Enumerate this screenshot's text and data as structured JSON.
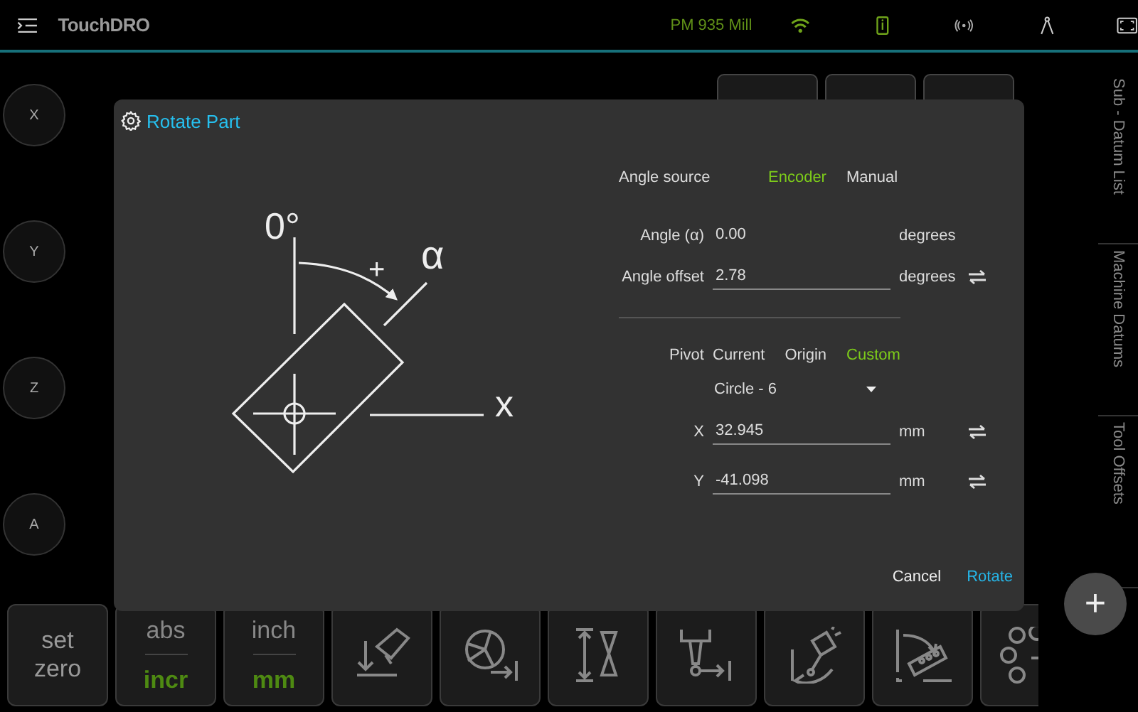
{
  "topbar": {
    "app_name": "TouchDRO",
    "machine": "PM 935 Mill"
  },
  "axes": [
    {
      "label": "X"
    },
    {
      "label": "Y"
    },
    {
      "label": "Z"
    },
    {
      "label": "A"
    }
  ],
  "side_tabs": [
    {
      "label": "Sub - Datum List"
    },
    {
      "label": "Machine Datums"
    },
    {
      "label": "Tool Offsets"
    }
  ],
  "dialog": {
    "title": "Rotate Part",
    "diagram_labels": [
      {
        "kind": "zero",
        "text": "0°"
      },
      {
        "kind": "plus",
        "text": "+"
      },
      {
        "kind": "alpha",
        "text": "α"
      },
      {
        "kind": "axis",
        "text": "x"
      }
    ],
    "angle_source": {
      "label": "Angle source",
      "options": [
        {
          "label": "Encoder",
          "selected": true
        },
        {
          "label": "Manual",
          "selected": false
        }
      ]
    },
    "fields": [
      {
        "kind": "readonly",
        "label": "Angle (α)",
        "value": "0.00",
        "unit": "degrees",
        "swap": false
      },
      {
        "kind": "input",
        "label": "Angle offset",
        "value": "2.78",
        "unit": "degrees",
        "swap": true
      }
    ],
    "pivot": {
      "label": "Pivot",
      "options": [
        {
          "label": "Current",
          "selected": false
        },
        {
          "label": "Origin",
          "selected": false
        },
        {
          "label": "Custom",
          "selected": true
        }
      ]
    },
    "pivot_point": {
      "value": "Circle - 6"
    },
    "coords": [
      {
        "label": "X",
        "value": "32.945",
        "unit": "mm",
        "swap": true
      },
      {
        "label": "Y",
        "value": "-41.098",
        "unit": "mm",
        "swap": true
      }
    ],
    "buttons": [
      {
        "kind": "cancel",
        "label": "Cancel"
      },
      {
        "kind": "confirm",
        "label": "Rotate"
      }
    ]
  },
  "toolbar": [
    {
      "kind": "text",
      "label": "set zero"
    },
    {
      "kind": "toggle",
      "options": [
        {
          "label": "abs",
          "selected": false
        },
        {
          "label": "incr",
          "selected": true
        }
      ]
    },
    {
      "kind": "toggle",
      "options": [
        {
          "label": "inch",
          "selected": false
        },
        {
          "label": "mm",
          "selected": true
        }
      ]
    },
    {
      "kind": "icon"
    },
    {
      "kind": "icon"
    },
    {
      "kind": "icon"
    },
    {
      "kind": "icon"
    },
    {
      "kind": "icon"
    },
    {
      "kind": "icon"
    },
    {
      "kind": "icon"
    }
  ],
  "fab": {
    "label": "+"
  }
}
